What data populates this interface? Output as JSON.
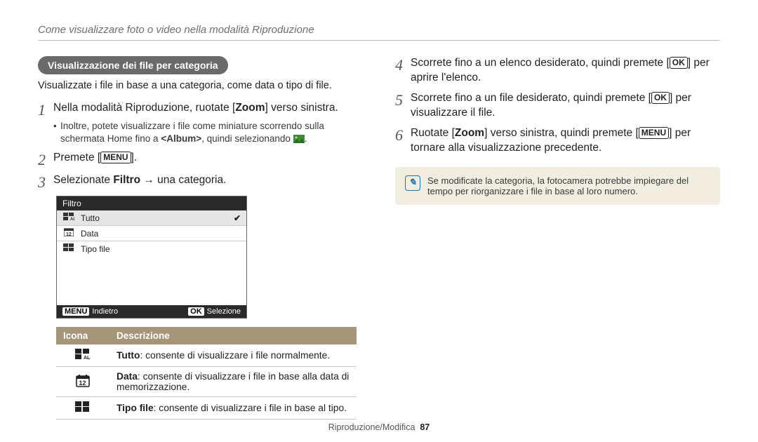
{
  "breadcrumb": "Come visualizzare foto o video nella modalità Riproduzione",
  "section_title": "Visualizzazione dei file per categoria",
  "intro": "Visualizzate i file in base a una categoria, come data o tipo di file.",
  "left_steps": {
    "s1_a": "Nella modalità Riproduzione, ruotate [",
    "s1_b": "Zoom",
    "s1_c": "] verso sinistra.",
    "s1_sub_a": "Inoltre, potete visualizzare i file come miniature scorrendo sulla schermata Home fino a ",
    "s1_sub_b": "<Album>",
    "s1_sub_c": ", quindi selezionando ",
    "s2_a": "Premete [",
    "s2_btn": "MENU",
    "s2_b": "].",
    "s3_a": "Selezionate ",
    "s3_b": "Filtro",
    "s3_c": " → una categoria."
  },
  "lcd": {
    "title": "Filtro",
    "r1": "Tutto",
    "r2": "Data",
    "r3": "Tipo file",
    "back_btn": "MENU",
    "back": "Indietro",
    "sel_btn": "OK",
    "sel": "Selezione"
  },
  "table": {
    "h1": "Icona",
    "h2": "Descrizione",
    "rows": [
      {
        "b": "Tutto",
        "t": ": consente di visualizzare i file normalmente."
      },
      {
        "b": "Data",
        "t": ": consente di visualizzare i file in base alla data di memorizzazione."
      },
      {
        "b": "Tipo file",
        "t": ": consente di visualizzare i file in base al tipo."
      }
    ]
  },
  "right_steps": {
    "s4_a": "Scorrete fino a un elenco desiderato, quindi premete [",
    "s4_btn": "OK",
    "s4_b": "] per aprire l'elenco.",
    "s5_a": "Scorrete fino a un file desiderato, quindi premete [",
    "s5_btn": "OK",
    "s5_b": "] per visualizzare il file.",
    "s6_a": "Ruotate [",
    "s6_b": "Zoom",
    "s6_c": "] verso sinistra, quindi premete [",
    "s6_btn": "MENU",
    "s6_d": "] per tornare alla visualizzazione precedente."
  },
  "note": "Se modificate la categoria, la fotocamera potrebbe impiegare del tempo per riorganizzare i file in base al loro numero.",
  "footer_label": "Riproduzione/Modifica",
  "page_number": "87"
}
